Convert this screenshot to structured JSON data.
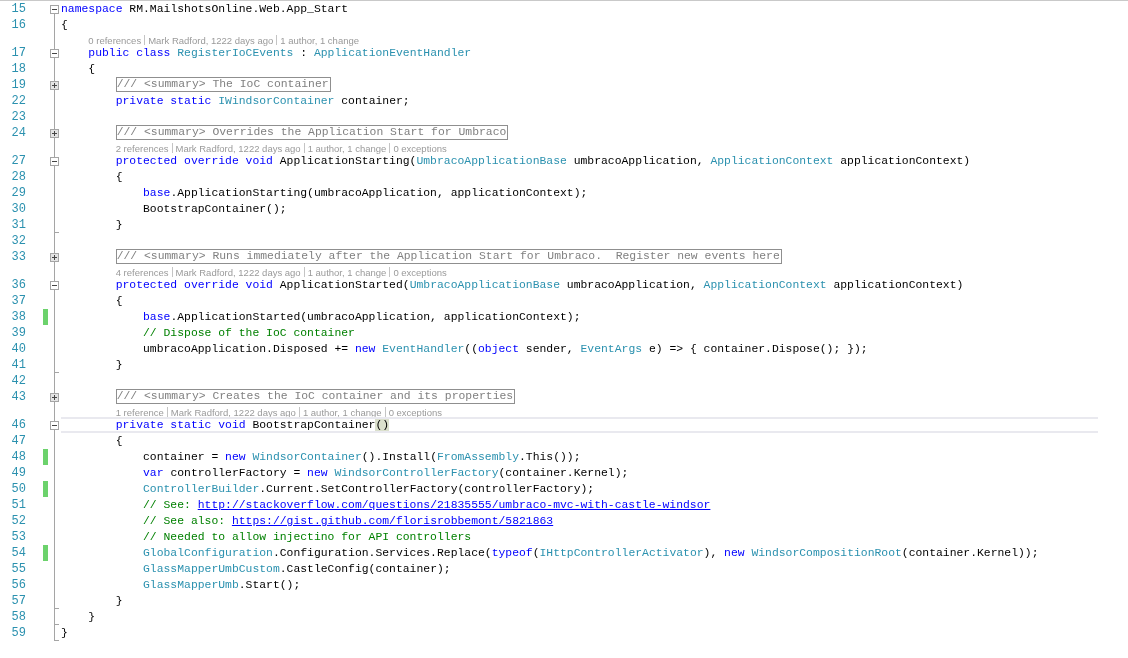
{
  "editor": {
    "lines": [
      {
        "kind": "code",
        "number": "15",
        "changed": false,
        "current": false,
        "block_end": false,
        "fold": {
          "expanded": true
        },
        "tokens": [
          {
            "kind": "keyword",
            "text": "namespace"
          },
          {
            "kind": "plain",
            "text": " RM.MailshotsOnline.Web.App_Start"
          }
        ]
      },
      {
        "kind": "code",
        "number": "16",
        "changed": false,
        "current": false,
        "block_end": false,
        "tokens": [
          {
            "kind": "plain",
            "text": "{"
          }
        ]
      },
      {
        "kind": "codelens",
        "items": [
          "0 references",
          "Mark Radford, 1222 days ago",
          "1 author, 1 change"
        ]
      },
      {
        "kind": "code",
        "number": "17",
        "changed": false,
        "current": false,
        "block_end": false,
        "fold": {
          "expanded": true
        },
        "tokens": [
          {
            "kind": "keyword",
            "text": "    public class "
          },
          {
            "kind": "type",
            "text": "RegisterIoCEvents"
          },
          {
            "kind": "plain",
            "text": " : "
          },
          {
            "kind": "type",
            "text": "ApplicationEventHandler"
          }
        ]
      },
      {
        "kind": "code",
        "number": "18",
        "changed": false,
        "current": false,
        "block_end": false,
        "tokens": [
          {
            "kind": "plain",
            "text": "    {"
          }
        ]
      },
      {
        "kind": "code",
        "number": "19",
        "changed": false,
        "current": false,
        "block_end": false,
        "fold": {
          "expanded": false
        },
        "tokens": [
          {
            "kind": "collapsed",
            "text": "        /// <summary> The IoC container"
          }
        ]
      },
      {
        "kind": "code",
        "number": "22",
        "changed": false,
        "current": false,
        "block_end": false,
        "tokens": [
          {
            "kind": "keyword",
            "text": "        private static "
          },
          {
            "kind": "type",
            "text": "IWindsorContainer"
          },
          {
            "kind": "plain",
            "text": " container;"
          }
        ]
      },
      {
        "kind": "code",
        "number": "23",
        "changed": false,
        "current": false,
        "block_end": false
      },
      {
        "kind": "code",
        "number": "24",
        "changed": false,
        "current": false,
        "block_end": false,
        "fold": {
          "expanded": false
        },
        "tokens": [
          {
            "kind": "collapsed",
            "text": "        /// <summary> Overrides the Application Start for Umbraco"
          }
        ]
      },
      {
        "kind": "codelens",
        "items": [
          "2 references",
          "Mark Radford, 1222 days ago",
          "1 author, 1 change",
          "0 exceptions"
        ]
      },
      {
        "kind": "code",
        "number": "27",
        "changed": false,
        "current": false,
        "block_end": false,
        "fold": {
          "expanded": true
        },
        "tokens": [
          {
            "kind": "keyword",
            "text": "        protected override void"
          },
          {
            "kind": "plain",
            "text": " ApplicationStarting("
          },
          {
            "kind": "type",
            "text": "UmbracoApplicationBase"
          },
          {
            "kind": "plain",
            "text": " umbracoApplication, "
          },
          {
            "kind": "type",
            "text": "ApplicationContext"
          },
          {
            "kind": "plain",
            "text": " applicationContext)"
          }
        ]
      },
      {
        "kind": "code",
        "number": "28",
        "changed": false,
        "current": false,
        "block_end": false,
        "tokens": [
          {
            "kind": "plain",
            "text": "        {"
          }
        ]
      },
      {
        "kind": "code",
        "number": "29",
        "changed": false,
        "current": false,
        "block_end": false,
        "tokens": [
          {
            "kind": "keyword",
            "text": "            base"
          },
          {
            "kind": "plain",
            "text": ".ApplicationStarting(umbracoApplication, applicationContext);"
          }
        ]
      },
      {
        "kind": "code",
        "number": "30",
        "changed": false,
        "current": false,
        "block_end": false,
        "tokens": [
          {
            "kind": "plain",
            "text": "            BootstrapContainer();"
          }
        ]
      },
      {
        "kind": "code",
        "number": "31",
        "changed": false,
        "current": false,
        "block_end": true,
        "tokens": [
          {
            "kind": "plain",
            "text": "        }"
          }
        ]
      },
      {
        "kind": "code",
        "number": "32",
        "changed": false,
        "current": false,
        "block_end": false
      },
      {
        "kind": "code",
        "number": "33",
        "changed": false,
        "current": false,
        "block_end": false,
        "fold": {
          "expanded": false
        },
        "tokens": [
          {
            "kind": "collapsed",
            "text": "        /// <summary> Runs immediately after the Application Start for Umbraco.  Register new events here"
          }
        ]
      },
      {
        "kind": "codelens",
        "items": [
          "4 references",
          "Mark Radford, 1222 days ago",
          "1 author, 1 change",
          "0 exceptions"
        ]
      },
      {
        "kind": "code",
        "number": "36",
        "changed": false,
        "current": false,
        "block_end": false,
        "fold": {
          "expanded": true
        },
        "tokens": [
          {
            "kind": "keyword",
            "text": "        protected override void"
          },
          {
            "kind": "plain",
            "text": " ApplicationStarted("
          },
          {
            "kind": "type",
            "text": "UmbracoApplicationBase"
          },
          {
            "kind": "plain",
            "text": " umbracoApplication, "
          },
          {
            "kind": "type",
            "text": "ApplicationContext"
          },
          {
            "kind": "plain",
            "text": " applicationContext)"
          }
        ]
      },
      {
        "kind": "code",
        "number": "37",
        "changed": false,
        "current": false,
        "block_end": false,
        "tokens": [
          {
            "kind": "plain",
            "text": "        {"
          }
        ]
      },
      {
        "kind": "code",
        "number": "38",
        "changed": true,
        "current": false,
        "block_end": false,
        "tokens": [
          {
            "kind": "keyword",
            "text": "            base"
          },
          {
            "kind": "plain",
            "text": ".ApplicationStarted(umbracoApplication, applicationContext);"
          }
        ]
      },
      {
        "kind": "code",
        "number": "39",
        "changed": false,
        "current": false,
        "block_end": false,
        "tokens": [
          {
            "kind": "comment",
            "text": "            // Dispose of the IoC container"
          }
        ]
      },
      {
        "kind": "code",
        "number": "40",
        "changed": false,
        "current": false,
        "block_end": false,
        "tokens": [
          {
            "kind": "plain",
            "text": "            umbracoApplication.Disposed += "
          },
          {
            "kind": "keyword",
            "text": "new "
          },
          {
            "kind": "type",
            "text": "EventHandler"
          },
          {
            "kind": "plain",
            "text": "(("
          },
          {
            "kind": "keyword",
            "text": "object"
          },
          {
            "kind": "plain",
            "text": " sender, "
          },
          {
            "kind": "type",
            "text": "EventArgs"
          },
          {
            "kind": "plain",
            "text": " e) => { container.Dispose(); });"
          }
        ]
      },
      {
        "kind": "code",
        "number": "41",
        "changed": false,
        "current": false,
        "block_end": true,
        "tokens": [
          {
            "kind": "plain",
            "text": "        }"
          }
        ]
      },
      {
        "kind": "code",
        "number": "42",
        "changed": false,
        "current": false,
        "block_end": false
      },
      {
        "kind": "code",
        "number": "43",
        "changed": false,
        "current": false,
        "block_end": false,
        "fold": {
          "expanded": false
        },
        "tokens": [
          {
            "kind": "collapsed",
            "text": "        /// <summary> Creates the IoC container and its properties"
          }
        ]
      },
      {
        "kind": "codelens",
        "items": [
          "1 reference",
          "Mark Radford, 1222 days ago",
          "1 author, 1 change",
          "0 exceptions"
        ]
      },
      {
        "kind": "code",
        "number": "46",
        "changed": false,
        "current": true,
        "block_end": false,
        "fold": {
          "expanded": true
        },
        "tokens": [
          {
            "kind": "keyword",
            "text": "        private static void"
          },
          {
            "kind": "plain",
            "text": " BootstrapContainer"
          },
          {
            "kind": "brace",
            "text": "()"
          }
        ]
      },
      {
        "kind": "code",
        "number": "47",
        "changed": false,
        "current": false,
        "block_end": false,
        "tokens": [
          {
            "kind": "plain",
            "text": "        {"
          }
        ]
      },
      {
        "kind": "code",
        "number": "48",
        "changed": true,
        "current": false,
        "block_end": false,
        "tokens": [
          {
            "kind": "plain",
            "text": "            container = "
          },
          {
            "kind": "keyword",
            "text": "new "
          },
          {
            "kind": "type",
            "text": "WindsorContainer"
          },
          {
            "kind": "plain",
            "text": "().Install("
          },
          {
            "kind": "type",
            "text": "FromAssembly"
          },
          {
            "kind": "plain",
            "text": ".This());"
          }
        ]
      },
      {
        "kind": "code",
        "number": "49",
        "changed": false,
        "current": false,
        "block_end": false,
        "tokens": [
          {
            "kind": "keyword",
            "text": "            var"
          },
          {
            "kind": "plain",
            "text": " controllerFactory = "
          },
          {
            "kind": "keyword",
            "text": "new "
          },
          {
            "kind": "type",
            "text": "WindsorControllerFactory"
          },
          {
            "kind": "plain",
            "text": "(container.Kernel);"
          }
        ]
      },
      {
        "kind": "code",
        "number": "50",
        "changed": true,
        "current": false,
        "block_end": false,
        "tokens": [
          {
            "kind": "type",
            "text": "            ControllerBuilder"
          },
          {
            "kind": "plain",
            "text": ".Current.SetControllerFactory(controllerFactory);"
          }
        ]
      },
      {
        "kind": "code",
        "number": "51",
        "changed": false,
        "current": false,
        "block_end": false,
        "tokens": [
          {
            "kind": "comment",
            "text": "            // See: "
          },
          {
            "kind": "link",
            "text": "http://stackoverflow.com/questions/21835555/umbraco-mvc-with-castle-windsor"
          }
        ]
      },
      {
        "kind": "code",
        "number": "52",
        "changed": false,
        "current": false,
        "block_end": false,
        "tokens": [
          {
            "kind": "comment",
            "text": "            // See also: "
          },
          {
            "kind": "link",
            "text": "https://gist.github.com/florisrobbemont/5821863"
          }
        ]
      },
      {
        "kind": "code",
        "number": "53",
        "changed": false,
        "current": false,
        "block_end": false,
        "tokens": [
          {
            "kind": "comment",
            "text": "            // Needed to allow injectino for API controllers"
          }
        ]
      },
      {
        "kind": "code",
        "number": "54",
        "changed": true,
        "current": false,
        "block_end": false,
        "tokens": [
          {
            "kind": "type",
            "text": "            GlobalConfiguration"
          },
          {
            "kind": "plain",
            "text": ".Configuration.Services.Replace("
          },
          {
            "kind": "keyword",
            "text": "typeof"
          },
          {
            "kind": "plain",
            "text": "("
          },
          {
            "kind": "type",
            "text": "IHttpControllerActivator"
          },
          {
            "kind": "plain",
            "text": "), "
          },
          {
            "kind": "keyword",
            "text": "new "
          },
          {
            "kind": "type",
            "text": "WindsorCompositionRoot"
          },
          {
            "kind": "plain",
            "text": "(container.Kernel));"
          }
        ]
      },
      {
        "kind": "code",
        "number": "55",
        "changed": false,
        "current": false,
        "block_end": false,
        "tokens": [
          {
            "kind": "type",
            "text": "            GlassMapperUmbCustom"
          },
          {
            "kind": "plain",
            "text": ".CastleConfig(container);"
          }
        ]
      },
      {
        "kind": "code",
        "number": "56",
        "changed": false,
        "current": false,
        "block_end": false,
        "tokens": [
          {
            "kind": "type",
            "text": "            GlassMapperUmb"
          },
          {
            "kind": "plain",
            "text": ".Start();"
          }
        ]
      },
      {
        "kind": "code",
        "number": "57",
        "changed": false,
        "current": false,
        "block_end": true,
        "tokens": [
          {
            "kind": "plain",
            "text": "        }"
          }
        ]
      },
      {
        "kind": "code",
        "number": "58",
        "changed": false,
        "current": false,
        "block_end": true,
        "tokens": [
          {
            "kind": "plain",
            "text": "    }"
          }
        ]
      },
      {
        "kind": "code",
        "number": "59",
        "changed": false,
        "current": false,
        "block_end": true,
        "tokens": [
          {
            "kind": "plain",
            "text": "}"
          }
        ]
      }
    ]
  }
}
